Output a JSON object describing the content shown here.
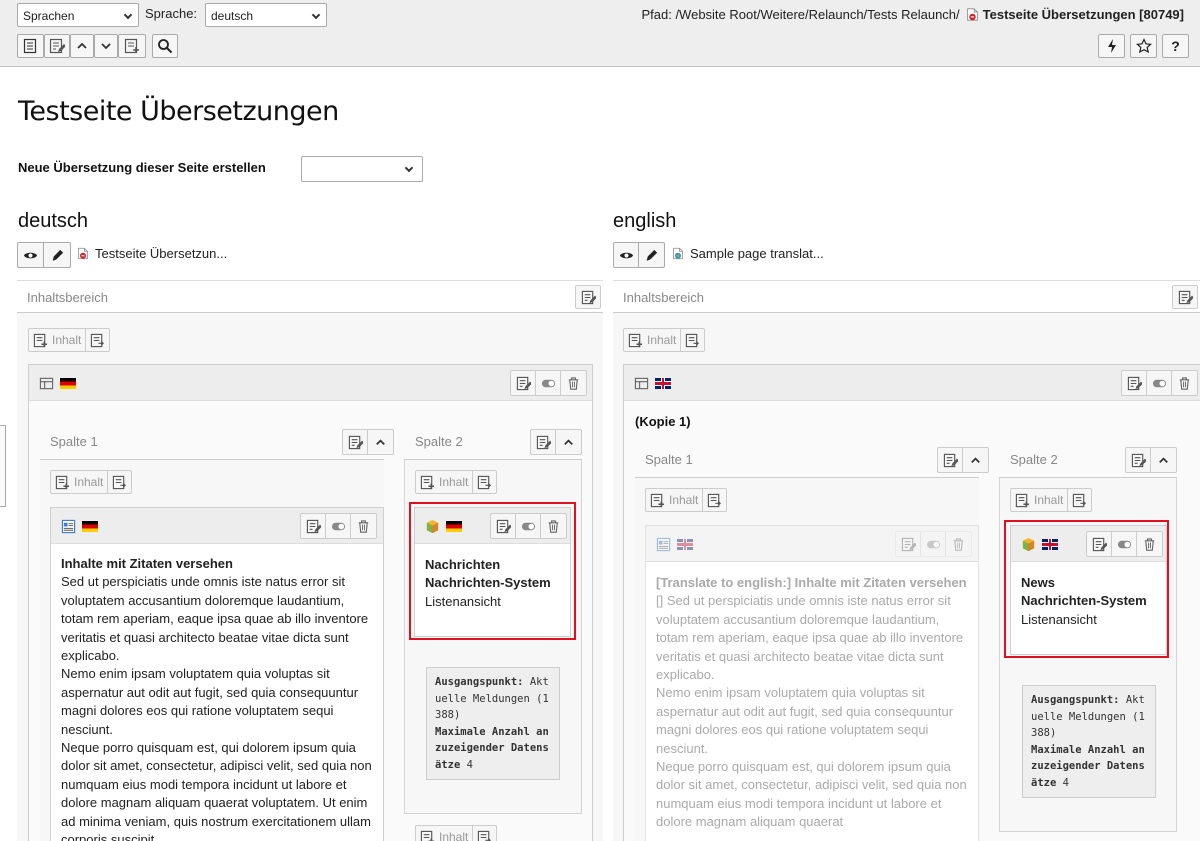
{
  "topbar": {
    "view_select": "Sprachen",
    "language_label": "Sprache:",
    "language_select": "deutsch",
    "path_label": "Pfad:",
    "path": "/Website Root/Weitere/Relaunch/Tests Relaunch/",
    "page_title": "Testseite Übersetzungen [80749]",
    "help_label": "?"
  },
  "page": {
    "title": "Testseite Übersetzungen",
    "new_translation_label": "Neue Übersetzung dieser Seite erstellen"
  },
  "left": {
    "language": "deutsch",
    "page_link": "Testseite Übersetzun...",
    "area_label": "Inhaltsbereich",
    "new_content": "Inhalt",
    "col1": "Spalte 1",
    "col2": "Spalte 2",
    "text_ce": {
      "header": "Inhalte mit Zitaten versehen",
      "paras": [
        "Sed ut perspiciatis unde omnis iste natus error sit voluptatem accusantium doloremque laudantium, totam rem aperiam, eaque ipsa quae ab illo inventore veritatis et quasi architecto beatae vitae dicta sunt explicabo.",
        "Nemo enim ipsam voluptatem quia voluptas sit aspernatur aut odit aut fugit, sed quia consequuntur magni dolores eos qui ratione voluptatem sequi nesciunt.",
        "Neque porro quisquam est, qui dolorem ipsum quia dolor sit amet, consectetur, adipisci velit, sed quia non numquam eius modi tempora incidunt ut labore et dolore magnam aliquam quaerat voluptatem. Ut enim ad minima veniam, quis nostrum exercitationem ullam corporis suscipit"
      ]
    },
    "plugin_ce": {
      "title1": "Nachrichten",
      "title2": "Nachrichten-System",
      "subtitle": "Listenansicht",
      "start_label": "Ausgangspunkt:",
      "start_value": "Aktuelle Meldungen (1388)",
      "max_label": "Maximale Anzahl anzuzeigender Datensätze",
      "max_value": "4"
    }
  },
  "right": {
    "language": "english",
    "page_link": "Sample page translat...",
    "area_label": "Inhaltsbereich",
    "new_content": "Inhalt",
    "kopie": "(Kopie 1)",
    "col1": "Spalte 1",
    "col2": "Spalte 2",
    "text_ce": {
      "header": "[Translate to english:] Inhalte mit Zitaten versehen",
      "paras": [
        "[] Sed ut perspiciatis unde omnis iste natus error sit voluptatem accusantium doloremque laudantium, totam rem aperiam, eaque ipsa quae ab illo inventore veritatis et quasi architecto beatae vitae dicta sunt explicabo.",
        "Nemo enim ipsam voluptatem quia voluptas sit aspernatur aut odit aut fugit, sed quia consequuntur magni dolores eos qui ratione voluptatem sequi nesciunt.",
        "Neque porro quisquam est, qui dolorem ipsum quia dolor sit amet, consectetur, adipisci velit, sed quia non numquam eius modi tempora incidunt ut labore et dolore magnam aliquam quaerat"
      ]
    },
    "plugin_ce": {
      "title1": "News",
      "title2": "Nachrichten-System",
      "subtitle": "Listenansicht",
      "start_label": "Ausgangspunkt:",
      "start_value": "Aktuelle Meldungen (1388)",
      "max_label": "Maximale Anzahl anzuzeigender Datensätze",
      "max_value": "4"
    }
  },
  "colors": {
    "highlight": "#e01020",
    "topbar_bg": "#eeeeee"
  }
}
